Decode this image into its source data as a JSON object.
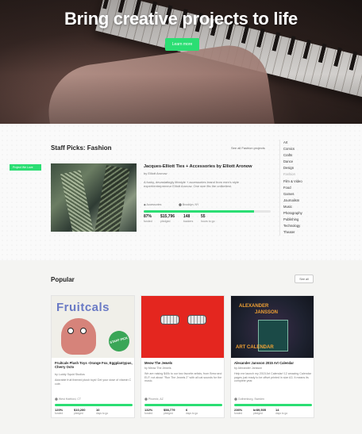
{
  "hero": {
    "title": "Bring creative projects to life",
    "button": "Learn more"
  },
  "staff_picks": {
    "title": "Staff Picks: Fashion",
    "see_all": "See all Fashion projects",
    "featured": {
      "ribbon": "Project We Love",
      "title": "Jacques-Elliott Ties + Accessories by Elliott Aronow",
      "by": "by Elliott Aronow",
      "description": "A funky, devastatingly lifestyle + accessories brand from men's style expert/entrepreneur Elliott Aronow. One size fits the unlikeliest.",
      "category": "Accessories",
      "location": "Brooklyn, NY",
      "progress_fraction": 0.87,
      "stats": [
        {
          "value": "87%",
          "label": "funded"
        },
        {
          "value": "$15,796",
          "label": "pledged"
        },
        {
          "value": "148",
          "label": "backers"
        },
        {
          "value": "55",
          "label": "hours to go"
        }
      ]
    },
    "categories": [
      "Art",
      "Comics",
      "Crafts",
      "Dance",
      "Design",
      "Fashion",
      "Film & Video",
      "Food",
      "Games",
      "Journalism",
      "Music",
      "Photography",
      "Publishing",
      "Technology",
      "Theater"
    ],
    "active_category": "Fashion"
  },
  "popular": {
    "title": "Popular",
    "see_all": "See all",
    "cards": [
      {
        "art_word": "Fruitcals",
        "art_badge": "STAFF PICK",
        "title": "Fruitcals Plush Toys -Orange Fox, Eggplantypus, Cherry Octo",
        "by": "by Luddy Squid Studios",
        "description": "Adorable fruit themed plush toys! Get your dose of vitamin C cute.",
        "location": "West Hartford, CT",
        "progress_fraction": 1.0,
        "stats": [
          {
            "value": "120%",
            "label": "funded"
          },
          {
            "value": "$10,200",
            "label": "pledged"
          },
          {
            "value": "10",
            "label": "days to go"
          }
        ]
      },
      {
        "title": "Meow The Jewels",
        "by": "by Meow The Jewels",
        "description": "We are raising $40k to our two favorite artists, from Brew and El-P, not about \"Run The Jewels 2\" with all cat sounds for the music.",
        "location": "Phoenix, AZ",
        "progress_fraction": 1.0,
        "stats": [
          {
            "value": "132%",
            "label": "funded"
          },
          {
            "value": "$58,779",
            "label": "pledged"
          },
          {
            "value": "6",
            "label": "days to go"
          }
        ]
      },
      {
        "art_line1": "ALEXANDER",
        "art_line2": "JANSSON",
        "art_line3": "ART CALENDAR",
        "title": "Alexander Jansson 2015 Art Calendar",
        "by": "by Alexander Jansson",
        "description": "Help me launch my 2015 Art Calendar! 12 amazing Calendar pages just ready to be offset printed in size A3. It means its complete year.",
        "location": "Gothenburg, Sweden",
        "progress_fraction": 1.0,
        "stats": [
          {
            "value": "236%",
            "label": "funded"
          },
          {
            "value": "kr89,505",
            "label": "pledged"
          },
          {
            "value": "14",
            "label": "days to go"
          }
        ]
      }
    ]
  },
  "icons": {
    "location": "map-pin-icon",
    "category": "tag-icon"
  },
  "colors": {
    "accent": "#2bde73"
  }
}
